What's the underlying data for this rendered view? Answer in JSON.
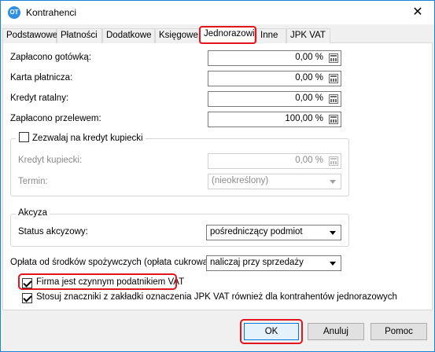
{
  "window": {
    "title": "Kontrahenci",
    "app_icon_text": "OT",
    "close_glyph": "✕"
  },
  "tabs": [
    {
      "label": "Podstawowe"
    },
    {
      "label": "Płatności"
    },
    {
      "label": "Dodatkowe"
    },
    {
      "label": "Księgowe"
    },
    {
      "label": "Jednorazowi",
      "active": true
    },
    {
      "label": "Inne"
    },
    {
      "label": "JPK VAT"
    }
  ],
  "payments": [
    {
      "label": "Zapłacono gotówką:",
      "value": "0,00 %"
    },
    {
      "label": "Karta płatnicza:",
      "value": "0,00 %"
    },
    {
      "label": "Kredyt ratalny:",
      "value": "0,00 %"
    },
    {
      "label": "Zapłacono przelewem:",
      "value": "100,00 %"
    }
  ],
  "merchant_credit": {
    "checkbox_label": "Zezwalaj na kredyt kupiecki",
    "checked": false,
    "credit_label": "Kredyt kupiecki:",
    "credit_value": "0,00 %",
    "term_label": "Termin:",
    "term_value": "(nieokreślony)"
  },
  "excise": {
    "group_title": "Akcyza",
    "status_label": "Status akcyzowy:",
    "status_value": "pośredniczący podmiot"
  },
  "sugar_fee": {
    "label": "Opłata od środków spożywczych (opłata cukrowa):",
    "value": "naliczaj przy sprzedaży"
  },
  "checkboxes": {
    "vat_active_label": "Firma jest czynnym podatnikiem VAT",
    "vat_active_checked": true,
    "jpk_marks_label": "Stosuj znaczniki z zakładki oznaczenia JPK VAT również dla kontrahentów jednorazowych",
    "jpk_marks_checked": true
  },
  "buttons": {
    "ok": "OK",
    "cancel": "Anuluj",
    "help": "Pomoc"
  },
  "colors": {
    "highlight": "#e0161c",
    "window_border": "#1883d7"
  }
}
